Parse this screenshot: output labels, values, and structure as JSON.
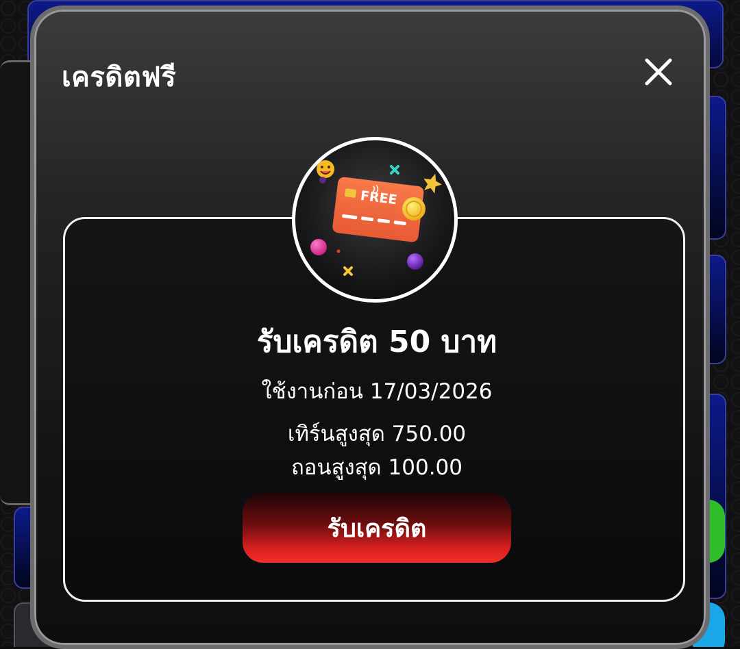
{
  "modal": {
    "title": "เครดิตฟรี",
    "close_icon": "close-icon"
  },
  "offer": {
    "image_icon": "free-credit-card-icon",
    "image_text": "FREE",
    "title": "รับเครดิต 50 บาท",
    "use_before": "ใช้งานก่อน 17/03/2026",
    "max_turnover": "เทิร์นสูงสุด 750.00",
    "max_withdraw": "ถอนสูงสุด 100.00",
    "claim_label": "รับเครดิต"
  },
  "colors": {
    "accent_red": "#e3231f",
    "card_orange": "#f26a3c",
    "background_blue": "#0c1a8a"
  }
}
